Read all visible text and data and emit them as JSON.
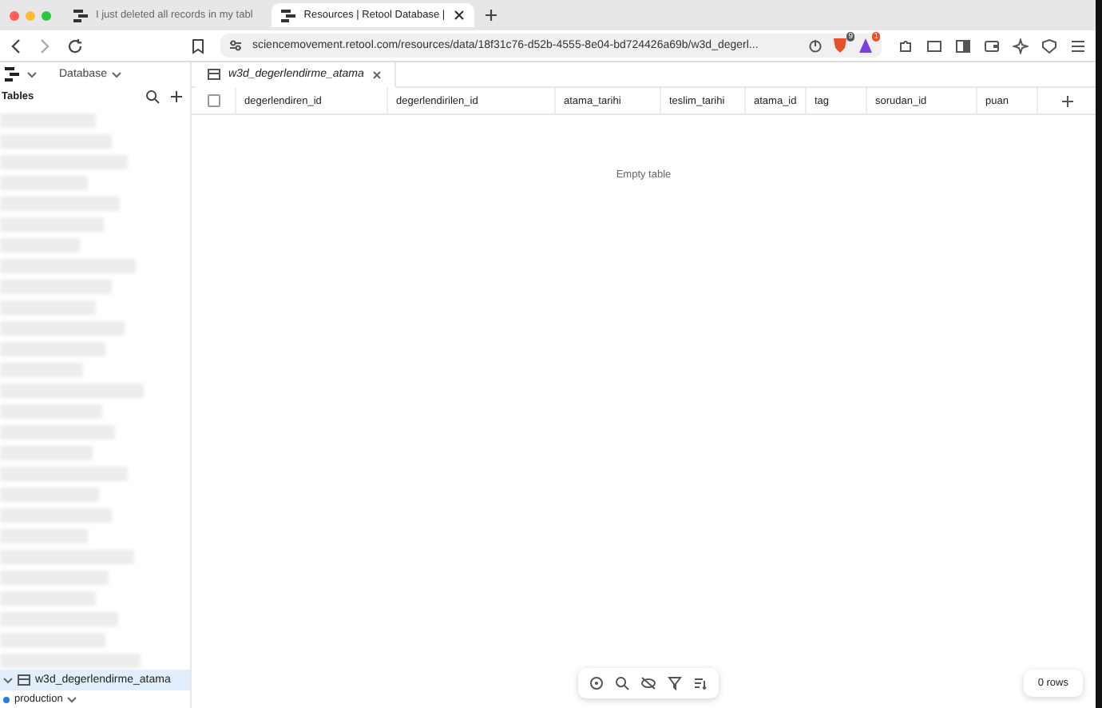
{
  "browser": {
    "tabs": [
      {
        "title": "I just deleted all records in my tabl",
        "selected": false
      },
      {
        "title": "Resources | Retool Database |",
        "selected": true
      }
    ],
    "address": "sciencemovement.retool.com/resources/data/18f31c76-d52b-4555-8e04-bd724426a69b/w3d_degerl...",
    "badges": [
      {
        "count": "9"
      },
      {
        "count": "1"
      }
    ]
  },
  "sidebar": {
    "title": "Database",
    "section": "Tables",
    "selected_table": {
      "name": "w3d_degerlendirme_atama",
      "selected": true
    },
    "environment": "production"
  },
  "editor_tab": {
    "name": "w3d_degerlendirme_atama",
    "selected": true
  },
  "table": {
    "select_all": {
      "checked": false
    },
    "columns": [
      {
        "label": "degerlendiren_id"
      },
      {
        "label": "degerlendirilen_id"
      },
      {
        "label": "atama_tarihi"
      },
      {
        "label": "teslim_tarihi"
      },
      {
        "label": "atama_id"
      },
      {
        "label": "tag"
      },
      {
        "label": "sorudan_id"
      },
      {
        "label": "puan"
      }
    ],
    "empty_message": "Empty table"
  },
  "status": {
    "row_count": "0 rows"
  }
}
